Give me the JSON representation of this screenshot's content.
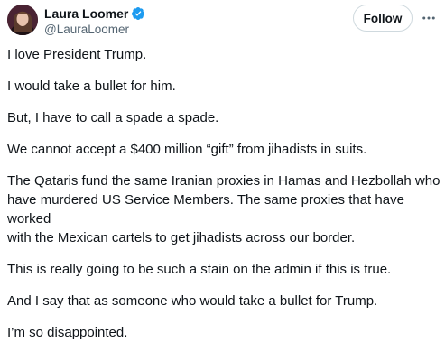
{
  "author": {
    "display_name": "Laura Loomer",
    "handle": "@LauraLoomer",
    "verified": true,
    "verified_color": "#1d9bf0",
    "avatar_icon": "profile-photo"
  },
  "actions": {
    "follow_label": "Follow",
    "more_icon": "more-horizontal-icon"
  },
  "tweet": {
    "paragraphs": [
      "I love President Trump.",
      "I would take a bullet for him.",
      "But, I have to call a spade a spade.",
      "We cannot accept a $400 million “gift” from jihadists in suits.",
      "The Qataris fund the same Iranian proxies in Hamas and Hezbollah who\nhave murdered US Service Members. The same proxies that have worked\nwith the Mexican cartels to get jihadists across our border.",
      "This is really going to be such a stain on the admin if this is true.",
      "And I say that as someone who would take a bullet for Trump.",
      "I’m so disappointed."
    ]
  },
  "colors": {
    "text_primary": "#0f1419",
    "text_secondary": "#536471",
    "border": "#cfd9de"
  }
}
